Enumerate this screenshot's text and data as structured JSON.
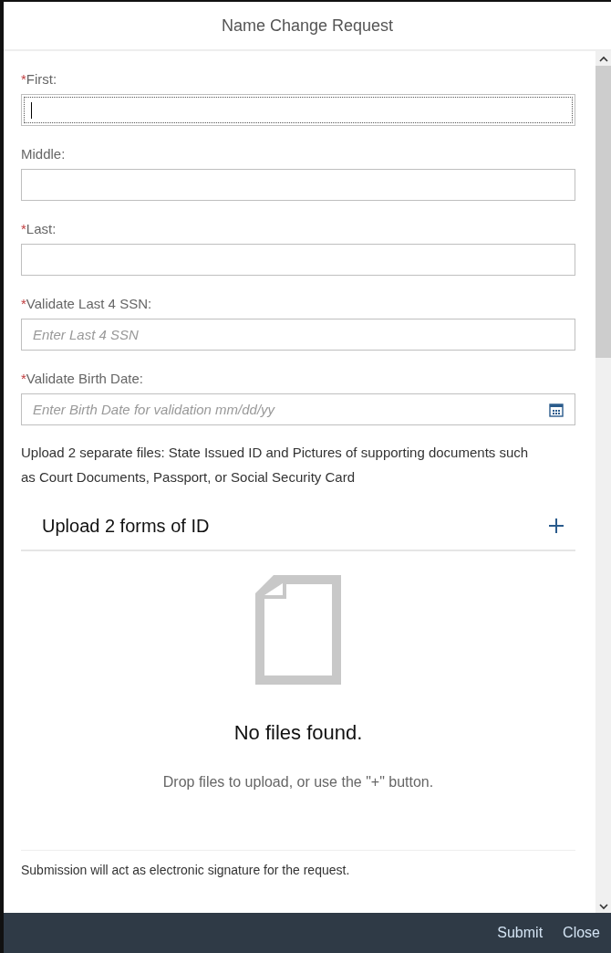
{
  "dialog": {
    "title": "Name Change Request"
  },
  "fields": [
    {
      "label": "First:",
      "required": true,
      "kind": "text",
      "focused": true
    },
    {
      "label": "Middle:",
      "required": false,
      "kind": "text",
      "focused": false
    },
    {
      "label": "Last:",
      "required": true,
      "kind": "text",
      "focused": false
    },
    {
      "label": "Validate Last 4 SSN:",
      "required": true,
      "kind": "text",
      "focused": false,
      "placeholder": "Enter Last 4 SSN"
    },
    {
      "label": "Validate Birth Date:",
      "required": true,
      "kind": "date",
      "focused": false,
      "placeholder": "Enter Birth Date for validation mm/dd/yy"
    }
  ],
  "required_mark": "*",
  "instructions": "Upload 2 separate files: State Issued ID and Pictures of supporting documents such as Court Documents, Passport, or Social Security Card",
  "upload": {
    "title": "Upload 2 forms of ID",
    "empty_title": "No files found.",
    "empty_hint": "Drop files to upload, or use the \"+\" button."
  },
  "signature_note": "Submission will act as electronic signature for the request.",
  "footer": {
    "buttons": [
      "Submit",
      "Close"
    ]
  }
}
